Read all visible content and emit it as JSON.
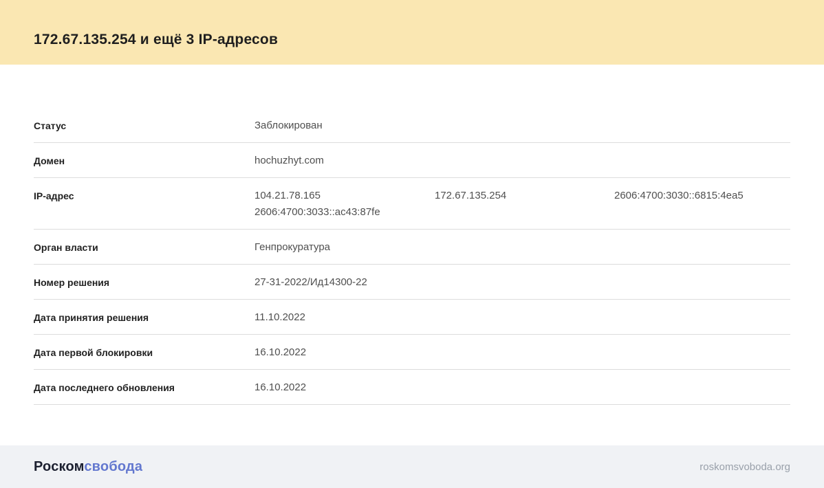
{
  "header": {
    "title": "172.67.135.254 и ещё 3 IP-адресов"
  },
  "table": {
    "rows": [
      {
        "label": "Статус",
        "value": "Заблокирован"
      },
      {
        "label": "Домен",
        "value": "hochuzhyt.com"
      },
      {
        "label": "IP-адрес",
        "values": [
          "104.21.78.165",
          "172.67.135.254",
          "2606:4700:3030::6815:4ea5",
          "2606:4700:3033::ac43:87fe"
        ]
      },
      {
        "label": "Орган власти",
        "value": "Генпрокуратура"
      },
      {
        "label": "Номер решения",
        "value": "27-31-2022/Ид14300-22"
      },
      {
        "label": "Дата принятия решения",
        "value": "11.10.2022"
      },
      {
        "label": "Дата первой блокировки",
        "value": "16.10.2022"
      },
      {
        "label": "Дата последнего обновления",
        "value": "16.10.2022"
      }
    ]
  },
  "footer": {
    "logo_part1": "Роском",
    "logo_part2": "свобода",
    "site_url": "roskomsvoboda.org"
  },
  "colors": {
    "header_bg": "#fae7b2",
    "footer_bg": "#f0f2f5",
    "divider": "#dcdcdc",
    "title_text": "#1f1f1f",
    "label_text": "#212121",
    "value_text": "#4f4f4f",
    "logo_dark": "#1c2030",
    "logo_accent": "#6378cf",
    "url_text": "#99a0aa"
  }
}
